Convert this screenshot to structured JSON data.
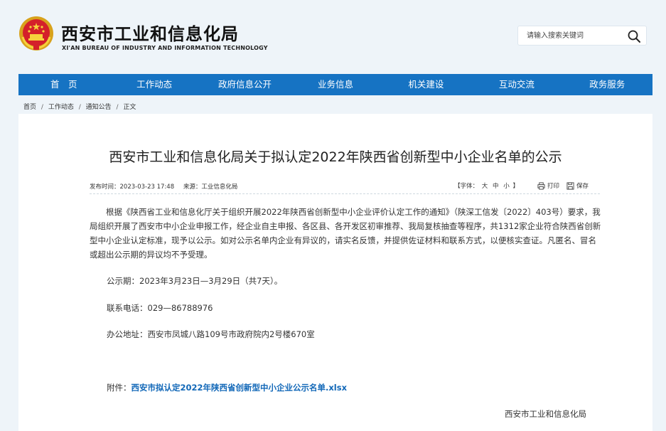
{
  "header": {
    "site_title": "西安市工业和信息化局",
    "site_subtitle": "XI'AN BUREAU OF INDUSTRY AND INFORMATION TECHNOLOGY",
    "search_placeholder": "请输入搜索关键词",
    "emblem_icon": "national-emblem-icon",
    "search_icon": "search-icon"
  },
  "nav": {
    "items": [
      {
        "label": "首　页"
      },
      {
        "label": "工作动态"
      },
      {
        "label": "政府信息公开"
      },
      {
        "label": "业务信息"
      },
      {
        "label": "机关建设"
      },
      {
        "label": "互动交流"
      },
      {
        "label": "政务服务"
      }
    ]
  },
  "breadcrumb": {
    "items": [
      "首页",
      "工作动态",
      "通知公告",
      "正文"
    ],
    "separator": "/"
  },
  "article": {
    "title": "西安市工业和信息化局关于拟认定2022年陕西省创新型中小企业名单的公示",
    "publish_time": "发布时间：2023-03-23 17:48",
    "source": "来源：工业信息化局",
    "font_label_open": "【字体：",
    "font_large": "大",
    "font_medium": "中",
    "font_small": "小",
    "font_label_close": "】",
    "print_label": "打印",
    "save_label": "保存",
    "paragraph1": "根据《陕西省工业和信息化厅关于组织开展2022年陕西省创新型中小企业评价认定工作的通知》（陕深工信发〔2022〕403号）要求，我局组织开展了西安市中小企业申报工作，经企业自主申报、各区县、各开发区初审推荐、我局复核抽查等程序，共1312家企业符合陕西省创新型中小企业认定标准，现予以公示。如对公示名单内企业有异议的，请实名反馈，并提供佐证材料和联系方式，以便核实查证。凡匿名、冒名或超出公示期的异议均不予受理。",
    "period": "公示期：2023年3月23日—3月29日（共7天）。",
    "phone": "联系电话：029—86788976",
    "address": "办公地址：西安市凤城八路109号市政府院内2号楼670室",
    "attachment_label": "附件：",
    "attachment_name": "西安市拟认定2022年陕西省创新型中小企业公示名单.xlsx",
    "signature": "西安市工业和信息化局"
  },
  "colors": {
    "nav_bg": "#1673c3",
    "page_bg": "#eef4f9",
    "link": "#1268b8"
  }
}
